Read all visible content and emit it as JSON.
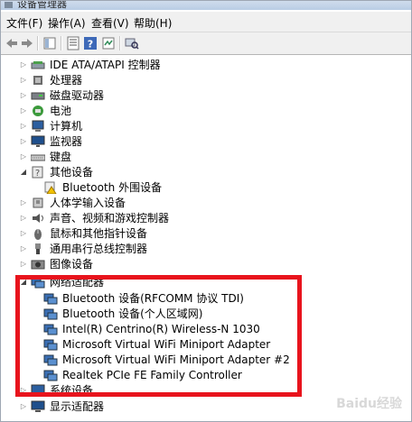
{
  "window": {
    "title": "设备管理器"
  },
  "menu": [
    "文件(F)",
    "操作(A)",
    "查看(V)",
    "帮助(H)"
  ],
  "tree": {
    "top_nodes": [
      {
        "label": "IDE ATA/ATAPI 控制器",
        "icon": "ide-controller-icon"
      },
      {
        "label": "处理器",
        "icon": "processor-icon"
      },
      {
        "label": "磁盘驱动器",
        "icon": "disk-drive-icon"
      },
      {
        "label": "电池",
        "icon": "battery-icon"
      },
      {
        "label": "计算机",
        "icon": "computer-icon"
      },
      {
        "label": "监视器",
        "icon": "monitor-icon"
      },
      {
        "label": "键盘",
        "icon": "keyboard-icon"
      },
      {
        "label": "其他设备",
        "icon": "other-devices-icon"
      }
    ],
    "other_child": "Bluetooth 外围设备",
    "mid_nodes": [
      {
        "label": "人体学输入设备",
        "icon": "hid-icon"
      },
      {
        "label": "声音、视频和游戏控制器",
        "icon": "sound-icon"
      },
      {
        "label": "鼠标和其他指针设备",
        "icon": "mouse-icon"
      },
      {
        "label": "通用串行总线控制器",
        "icon": "usb-icon"
      },
      {
        "label": "图像设备",
        "icon": "imaging-icon"
      },
      {
        "label": "网络适配器",
        "icon": "network-adapter-icon"
      }
    ],
    "network_children": [
      "Bluetooth 设备(RFCOMM 协议 TDI)",
      "Bluetooth 设备(个人区域网)",
      "Intel(R) Centrino(R) Wireless-N 1030",
      "Microsoft Virtual WiFi Miniport Adapter",
      "Microsoft Virtual WiFi Miniport Adapter #2",
      "Realtek PCIe FE Family Controller"
    ],
    "bottom_nodes": [
      {
        "label": "系统设备",
        "icon": "system-devices-icon"
      },
      {
        "label": "显示适配器",
        "icon": "display-adapter-icon"
      }
    ]
  },
  "watermark": "Baidu经验",
  "colors": {
    "highlight": "#e8141d"
  }
}
